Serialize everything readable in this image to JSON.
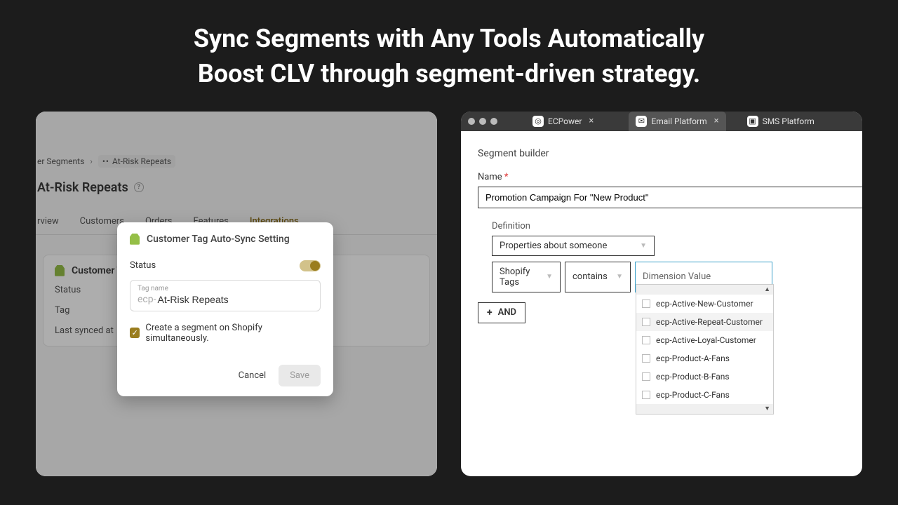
{
  "headline": {
    "line1": "Sync Segments with Any Tools Automatically",
    "line2": "Boost CLV through segment-driven strategy."
  },
  "left": {
    "breadcrumb": {
      "root": "er Segments",
      "current": "At-Risk Repeats"
    },
    "page_title": "At-Risk Repeats",
    "tabs": {
      "overview": "rview",
      "customers": "Customers",
      "orders": "Orders",
      "features": "Features",
      "integrations": "Integrations"
    },
    "section": {
      "title": "Customer Tag A",
      "rows": {
        "status": "Status",
        "tag": "Tag",
        "last_synced": "Last synced at"
      }
    },
    "modal": {
      "title": "Customer Tag Auto-Sync Setting",
      "status_label": "Status",
      "tag_name_label": "Tag name",
      "tag_prefix": "ecp-",
      "tag_value": "At-Risk Repeats",
      "checkbox_label": "Create a segment on Shopify simultaneously.",
      "cancel": "Cancel",
      "save": "Save"
    }
  },
  "right": {
    "tabs": {
      "ecpower": "ECPower",
      "email": "Email Platform",
      "sms": "SMS Platform"
    },
    "segment_builder_title": "Segment builder",
    "name_label": "Name",
    "name_value": "Promotion Campaign For \"New Product\"",
    "definition_label": "Definition",
    "definition_value": "Properties about someone",
    "filter": {
      "field": "Shopify Tags",
      "operator": "contains",
      "placeholder": "Dimension Value"
    },
    "dropdown": [
      "ecp-Active-New-Customer",
      "ecp-Active-Repeat-Customer",
      "ecp-Active-Loyal-Customer",
      "ecp-Product-A-Fans",
      "ecp-Product-B-Fans",
      "ecp-Product-C-Fans"
    ],
    "and_label": "AND"
  }
}
